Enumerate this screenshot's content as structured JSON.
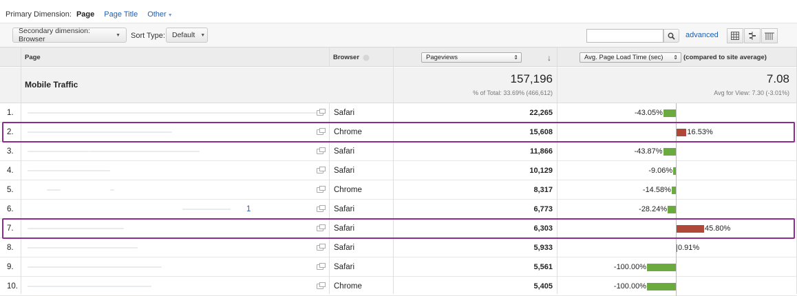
{
  "primary": {
    "label": "Primary Dimension:",
    "active": "Page",
    "links": [
      "Page Title",
      "Other"
    ]
  },
  "toolbar": {
    "secondary_dimension": "Secondary dimension: Browser",
    "sort_type_label": "Sort Type:",
    "sort_type_value": "Default",
    "search_placeholder": "",
    "advanced": "advanced"
  },
  "table": {
    "headers": {
      "page": "Page",
      "browser": "Browser",
      "pageviews": "Pageviews",
      "metric": "Avg. Page Load Time (sec)",
      "compare": "(compared to site average)"
    },
    "summary": {
      "label": "Mobile Traffic",
      "pageviews": "157,196",
      "pageviews_note": "% of Total: 33.69% (466,612)",
      "metric": "7.08",
      "metric_note": "Avg for View: 7.30 (-3.01%)"
    },
    "rows": [
      {
        "index": "1.",
        "page_extra": "",
        "browser": "Safari",
        "pageviews": "22,265",
        "pct": "-43.05%",
        "pct_value": -43.05
      },
      {
        "index": "2.",
        "page_extra": "",
        "browser": "Chrome",
        "pageviews": "15,608",
        "pct": "16.53%",
        "pct_value": 16.53
      },
      {
        "index": "3.",
        "page_extra": "",
        "browser": "Safari",
        "pageviews": "11,866",
        "pct": "-43.87%",
        "pct_value": -43.87
      },
      {
        "index": "4.",
        "page_extra": "",
        "browser": "Safari",
        "pageviews": "10,129",
        "pct": "-9.06%",
        "pct_value": -9.06
      },
      {
        "index": "5.",
        "page_extra": "",
        "browser": "Chrome",
        "pageviews": "8,317",
        "pct": "-14.58%",
        "pct_value": -14.58
      },
      {
        "index": "6.",
        "page_extra": "1",
        "browser": "Safari",
        "pageviews": "6,773",
        "pct": "-28.24%",
        "pct_value": -28.24
      },
      {
        "index": "7.",
        "page_extra": "",
        "browser": "Safari",
        "pageviews": "6,303",
        "pct": "45.80%",
        "pct_value": 45.8
      },
      {
        "index": "8.",
        "page_extra": "",
        "browser": "Safari",
        "pageviews": "5,933",
        "pct": "0.91%",
        "pct_value": 0.91
      },
      {
        "index": "9.",
        "page_extra": "",
        "browser": "Safari",
        "pageviews": "5,561",
        "pct": "-100.00%",
        "pct_value": -100.0
      },
      {
        "index": "10.",
        "page_extra": "",
        "browser": "Chrome",
        "pageviews": "5,405",
        "pct": "-100.00%",
        "pct_value": -100.0
      }
    ],
    "highlighted_rows": [
      "2.",
      "7."
    ]
  },
  "colors": {
    "positive_bar": "#b0483a",
    "negative_bar": "#6aaa3f",
    "highlight": "#8e2a91",
    "link": "#1a5fb4"
  },
  "icons": {
    "search": "search-icon",
    "view_table": "table-view-icon",
    "view_compare": "comparison-view-icon",
    "view_pivot": "pivot-view-icon",
    "external": "external-link-icon"
  }
}
